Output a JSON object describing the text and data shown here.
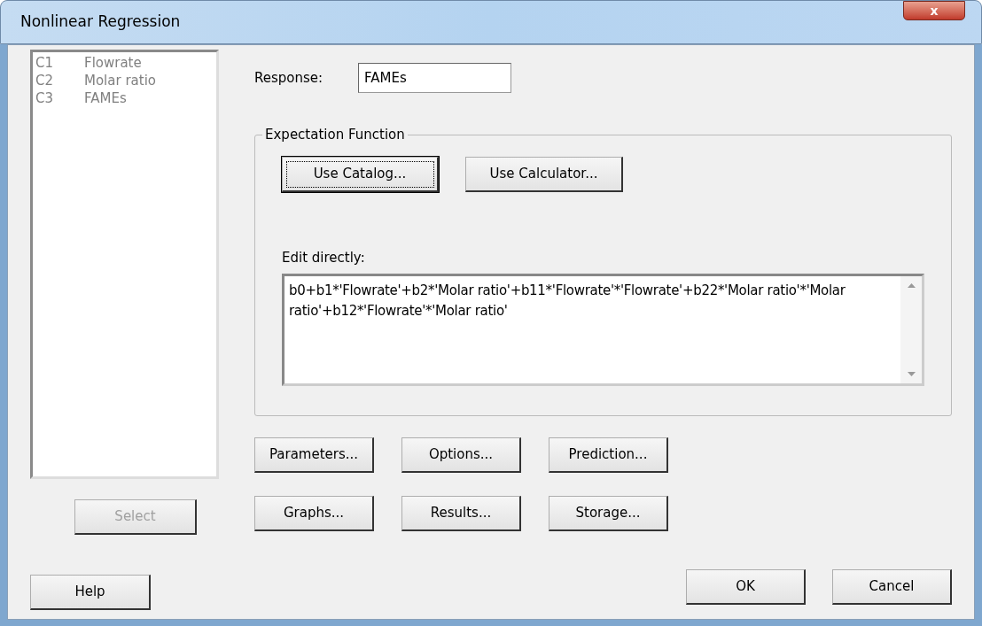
{
  "window": {
    "title": "Nonlinear Regression",
    "close_label": "x"
  },
  "columns": [
    {
      "id": "C1",
      "name": "Flowrate",
      "selected": false
    },
    {
      "id": "C2",
      "name": "Molar ratio",
      "selected": false
    },
    {
      "id": "C3",
      "name": "FAMEs",
      "selected": false
    }
  ],
  "select_button": {
    "label": "Select",
    "disabled": true
  },
  "response": {
    "label": "Response:",
    "value": "FAMEs"
  },
  "expectation_function": {
    "title": "Expectation Function",
    "buttons": [
      {
        "label": "Use Catalog...",
        "focused": true
      },
      {
        "label": "Use Calculator...",
        "focused": false
      }
    ],
    "edit_label": "Edit directly:",
    "expression": "b0+b1*'Flowrate'+b2*'Molar ratio'+b11*'Flowrate'*'Flowrate'+b22*'Molar ratio'*'Molar ratio'+b12*'Flowrate'*'Molar ratio'"
  },
  "option_buttons": [
    {
      "label": "Parameters..."
    },
    {
      "label": "Options..."
    },
    {
      "label": "Prediction..."
    },
    {
      "label": "Graphs..."
    },
    {
      "label": "Results..."
    },
    {
      "label": "Storage..."
    }
  ],
  "help_button": {
    "label": "Help"
  },
  "ok_button": {
    "label": "OK"
  },
  "cancel_button": {
    "label": "Cancel"
  }
}
